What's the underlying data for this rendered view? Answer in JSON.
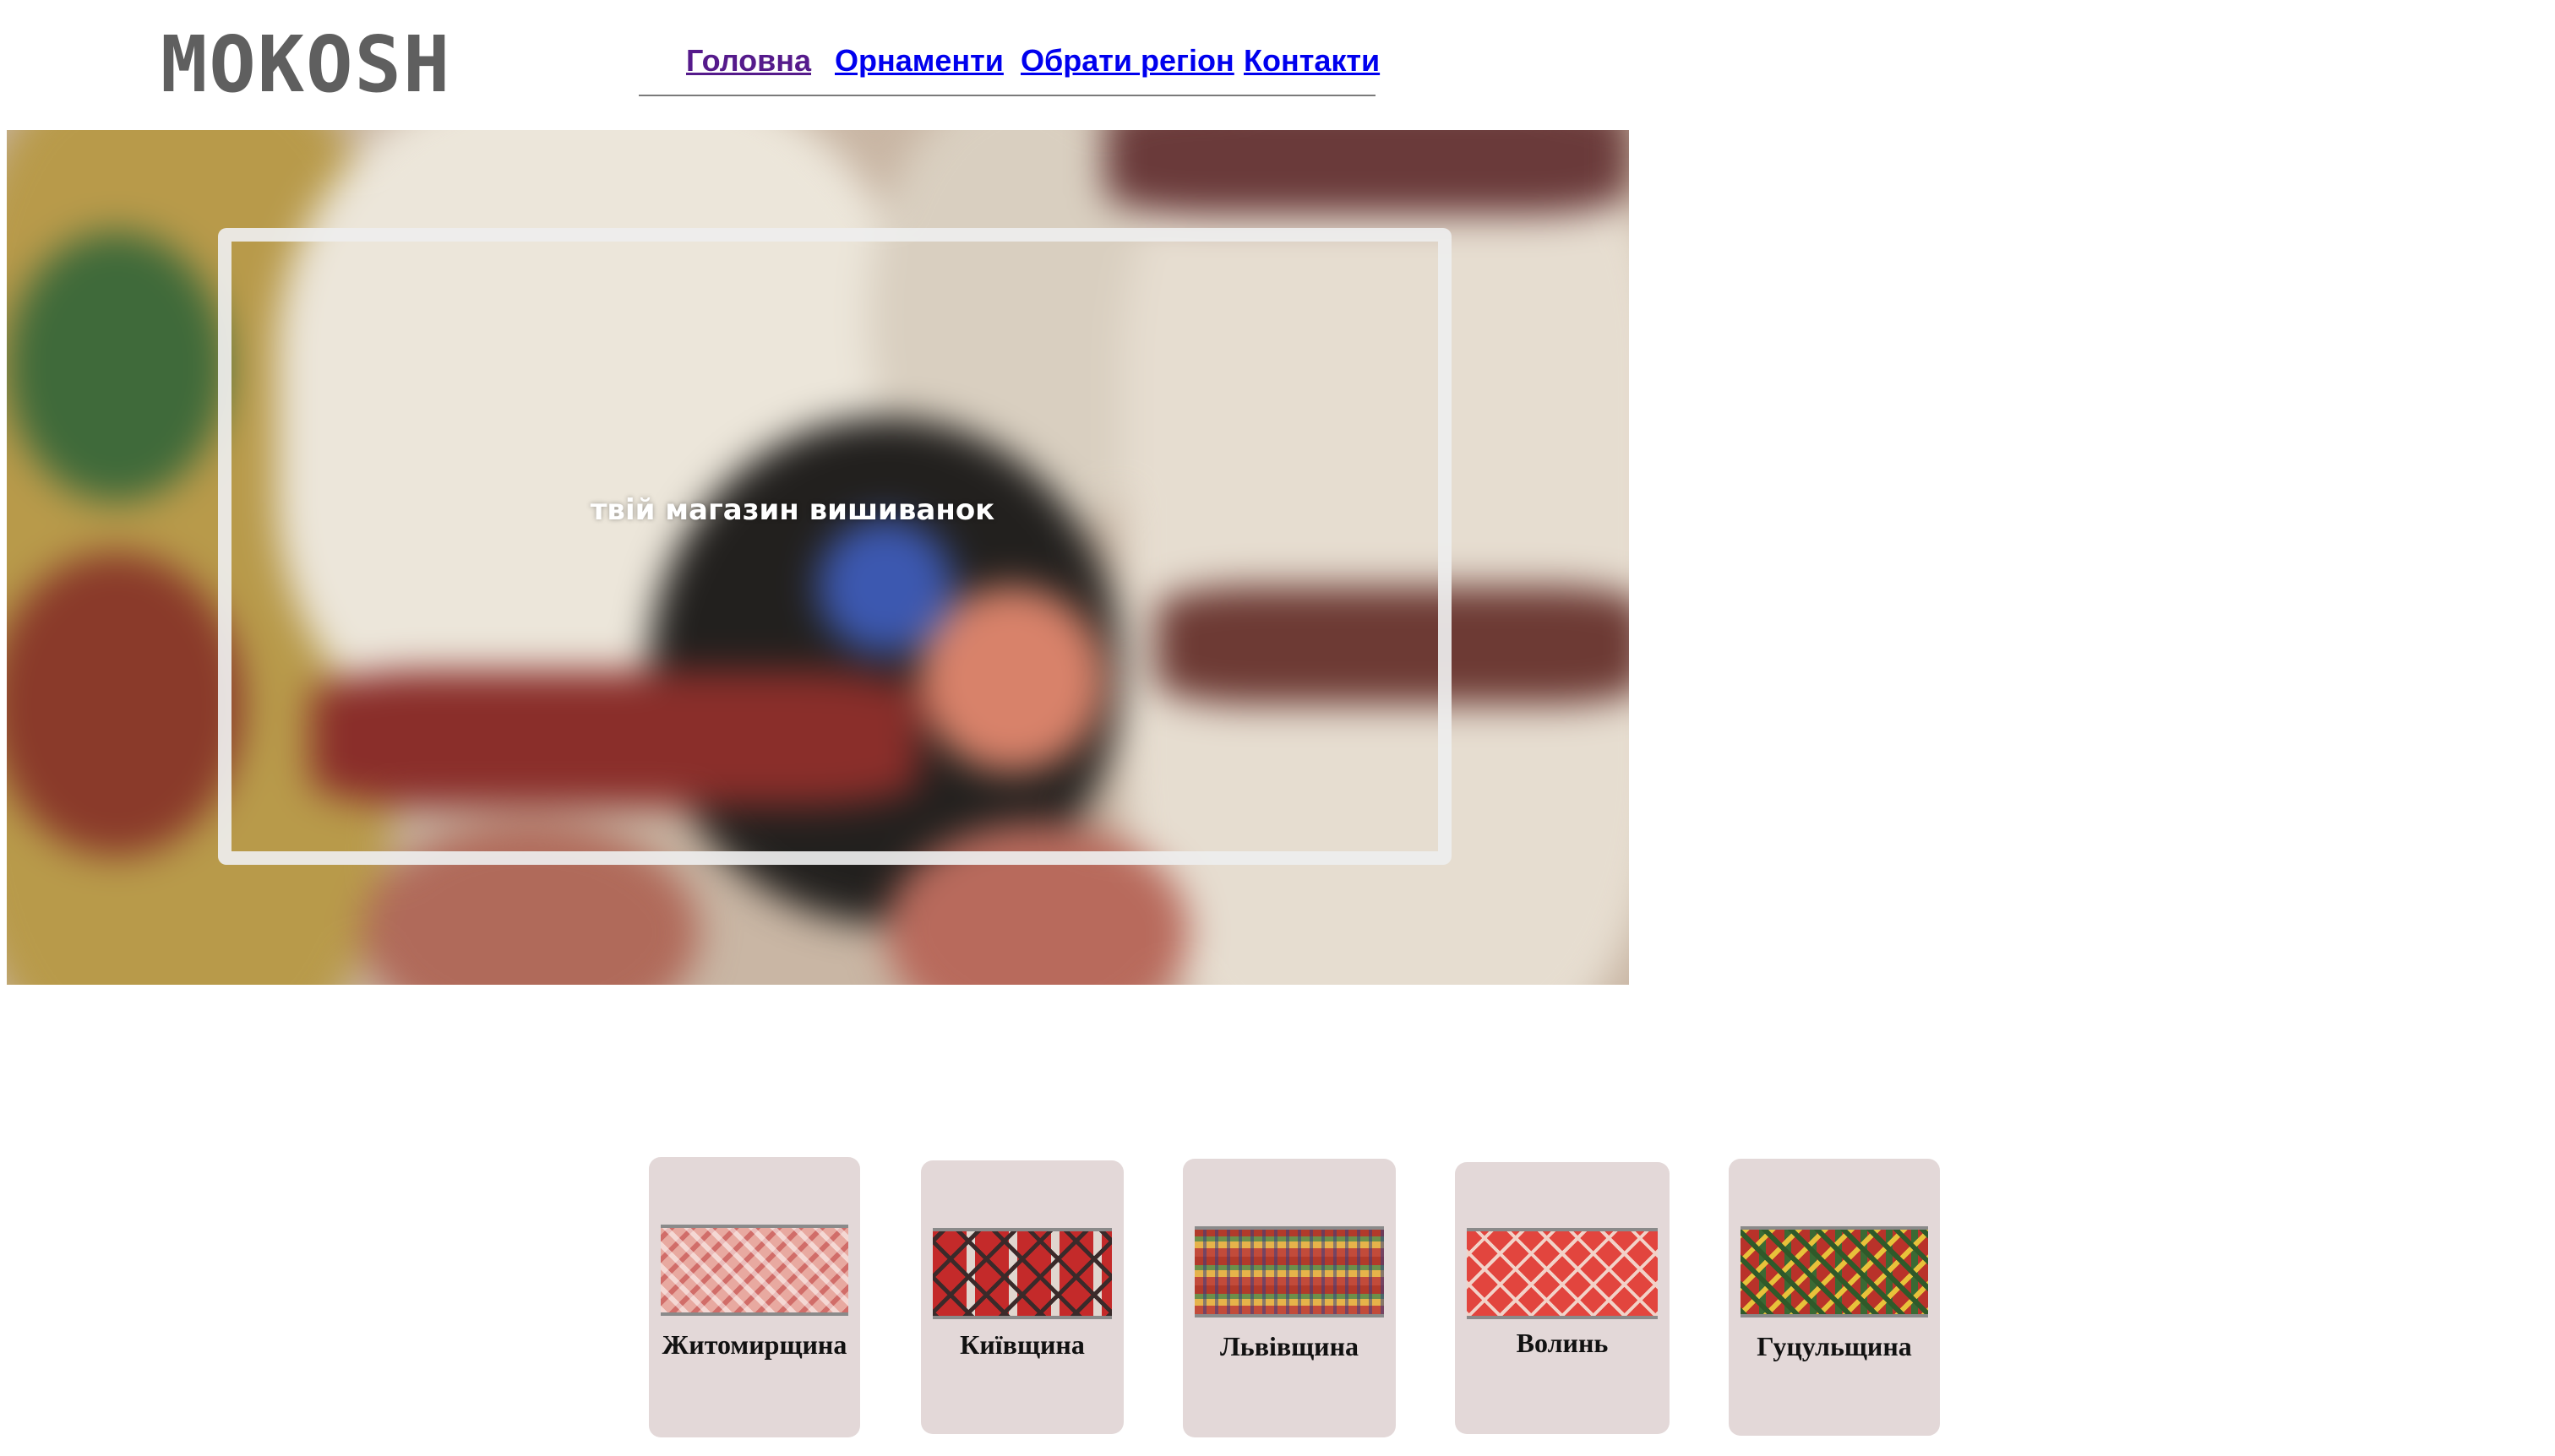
{
  "header": {
    "logo": "MOKOSH",
    "nav": [
      {
        "label": "Головна",
        "state": "visited"
      },
      {
        "label": "Орнаменти",
        "state": "link"
      },
      {
        "label": "Обрати регіон",
        "state": "link"
      },
      {
        "label": "Контакти",
        "state": "link"
      }
    ]
  },
  "hero": {
    "tagline": "твій магазин вишиванок"
  },
  "regions": [
    {
      "name": "Житомирщина",
      "ornament": "zhytomyr-ornament-image"
    },
    {
      "name": "Київщина",
      "ornament": "kyiv-ornament-image"
    },
    {
      "name": "Львівщина",
      "ornament": "lviv-ornament-image"
    },
    {
      "name": "Волинь",
      "ornament": "volyn-ornament-image"
    },
    {
      "name": "Гуцульщина",
      "ornament": "hutsul-ornament-image"
    }
  ],
  "colors": {
    "link": "#0000ee",
    "link_visited": "#551a8b",
    "logo": "#5f5f5f",
    "card_background": "#e3d8d8"
  }
}
